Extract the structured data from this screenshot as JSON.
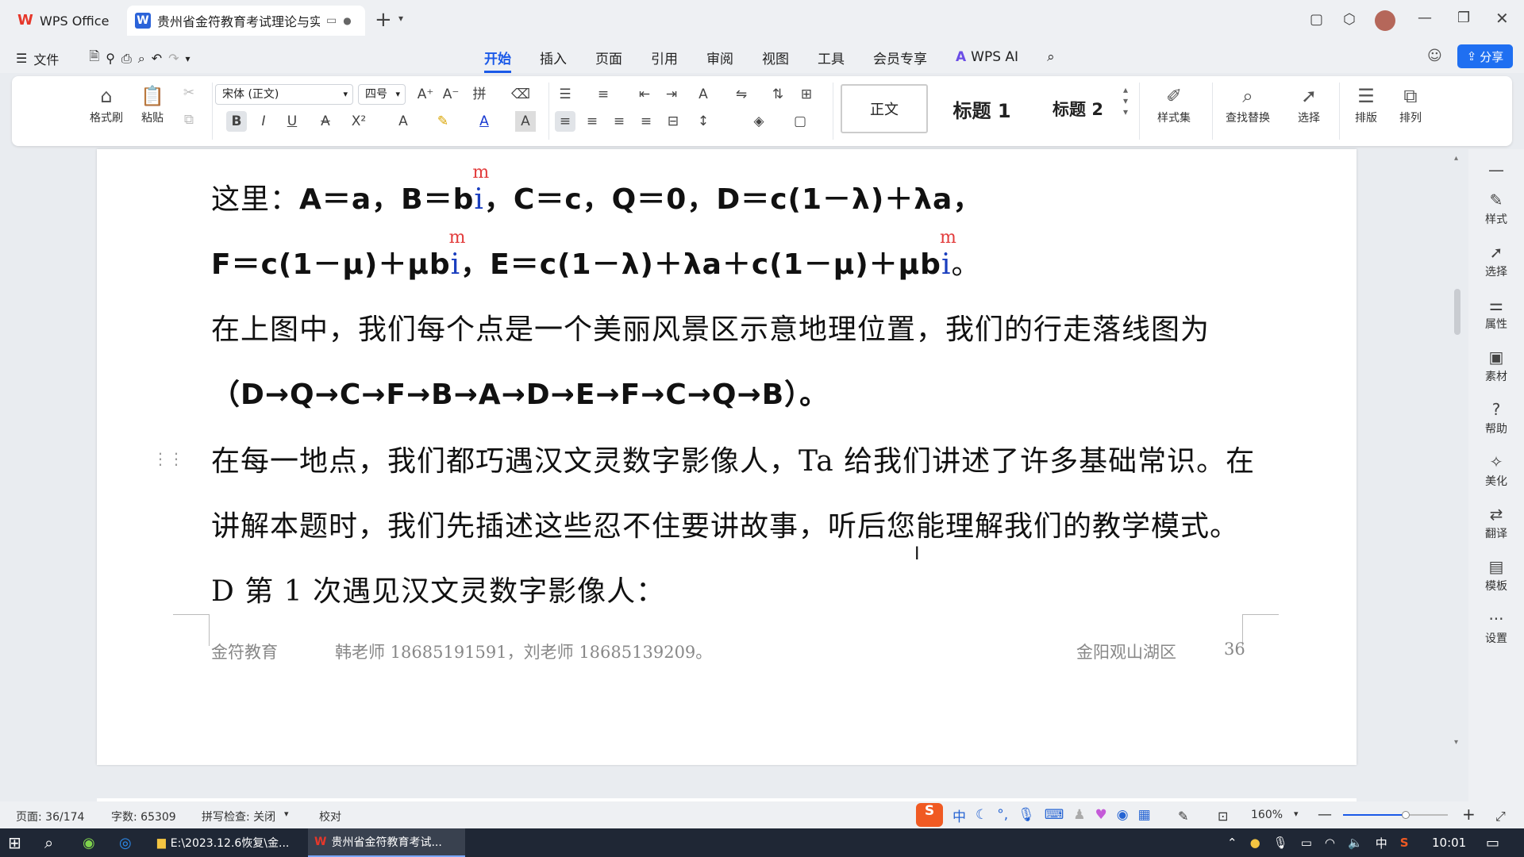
{
  "titlebar": {
    "tab1_label": "WPS Office",
    "tab2_label": "贵州省金符教育考试理论与实践",
    "new_tab": "+"
  },
  "menubar": {
    "file_label": "文件",
    "tabs": [
      "开始",
      "插入",
      "页面",
      "引用",
      "审阅",
      "视图",
      "工具",
      "会员专享"
    ],
    "wps_ai_label": "WPS AI",
    "share_label": "分享"
  },
  "ribbon": {
    "format_painter": "格式刷",
    "paste": "粘贴",
    "font_name": "宋体 (正文)",
    "font_size": "四号",
    "style_normal": "正文",
    "style_h1": "标题 1",
    "style_h2": "标题 2",
    "style_set": "样式集",
    "find_replace": "查找替换",
    "select": "选择",
    "layout": "排版",
    "arrange": "排列"
  },
  "document": {
    "line1_prefix": "这里：",
    "line1_a": "A＝a，B＝b",
    "line1_b": "，C＝c，Q＝0，D＝c(1－λ)＋λa，",
    "line2_a": "F＝c(1－μ)＋μb",
    "line2_b": "，E＝c(1－λ)＋λa＋c(1－μ)＋μb",
    "line2_end": "。",
    "ibar_char": "i",
    "ibar_mark": "m",
    "line3": "在上图中，我们每个点是一个美丽风景区示意地理位置，我们的行走落线图为",
    "line4": "（D→Q→C→F→B→A→D→E→F→C→Q→B）。",
    "line5": "在每一地点，我们都巧遇汉文灵数字影像人，Ta 给我们讲述了许多基础常识。在",
    "line6": "讲解本题时，我们先插述这些忍不住要讲故事，听后您能理解我们的教学模式。",
    "line7": "D 第 1 次遇见汉文灵数字影像人：",
    "footer_left": "金符教育",
    "footer_contact": "韩老师 18685191591，刘老师 18685139209。",
    "footer_location": "金阳观山湖区",
    "footer_page": "36"
  },
  "sidebar": [
    "样式",
    "选择",
    "属性",
    "素材",
    "帮助",
    "美化",
    "翻译",
    "模板",
    "设置"
  ],
  "statusbar": {
    "page": "页面: 36/174",
    "words": "字数: 65309",
    "spell": "拼写检查: 关闭",
    "proof": "校对",
    "zoom": "160%"
  },
  "taskbar": {
    "app1": "E:\\2023.12.6恢复\\金...",
    "app2": "贵州省金符教育考试...",
    "ime": "中",
    "time": "10:01"
  }
}
